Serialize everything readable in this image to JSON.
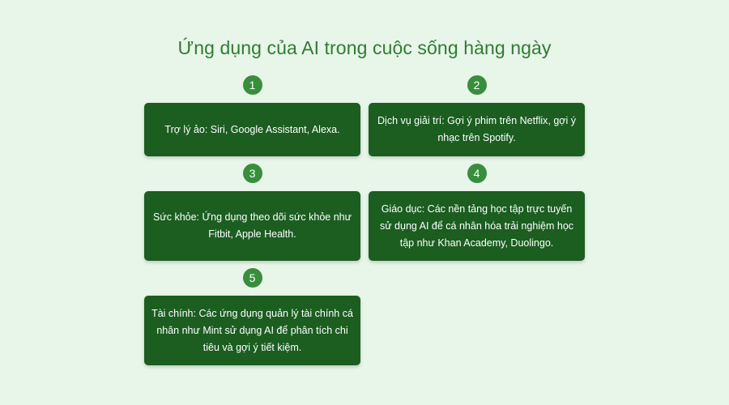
{
  "title": "Ứng dụng của AI trong cuộc sống hàng ngày",
  "items": [
    {
      "number": "1",
      "text": "Trợ lý ảo: Siri, Google Assistant, Alexa."
    },
    {
      "number": "2",
      "text": "Dịch vụ giải trí: Gợi ý phim trên Netflix, gợi ý nhạc trên Spotify."
    },
    {
      "number": "3",
      "text": "Sức khỏe: Ứng dụng theo dõi sức khỏe như Fitbit, Apple Health."
    },
    {
      "number": "4",
      "text": "Giáo dục: Các nền tảng học tập trực tuyến sử dụng AI để cá nhân hóa trải nghiệm học tập như Khan Academy, Duolingo."
    },
    {
      "number": "5",
      "text": "Tài chính: Các ứng dụng quản lý tài chính cá nhân như Mint sử dụng AI để phân tích chi tiêu và gợi ý tiết kiệm."
    }
  ]
}
